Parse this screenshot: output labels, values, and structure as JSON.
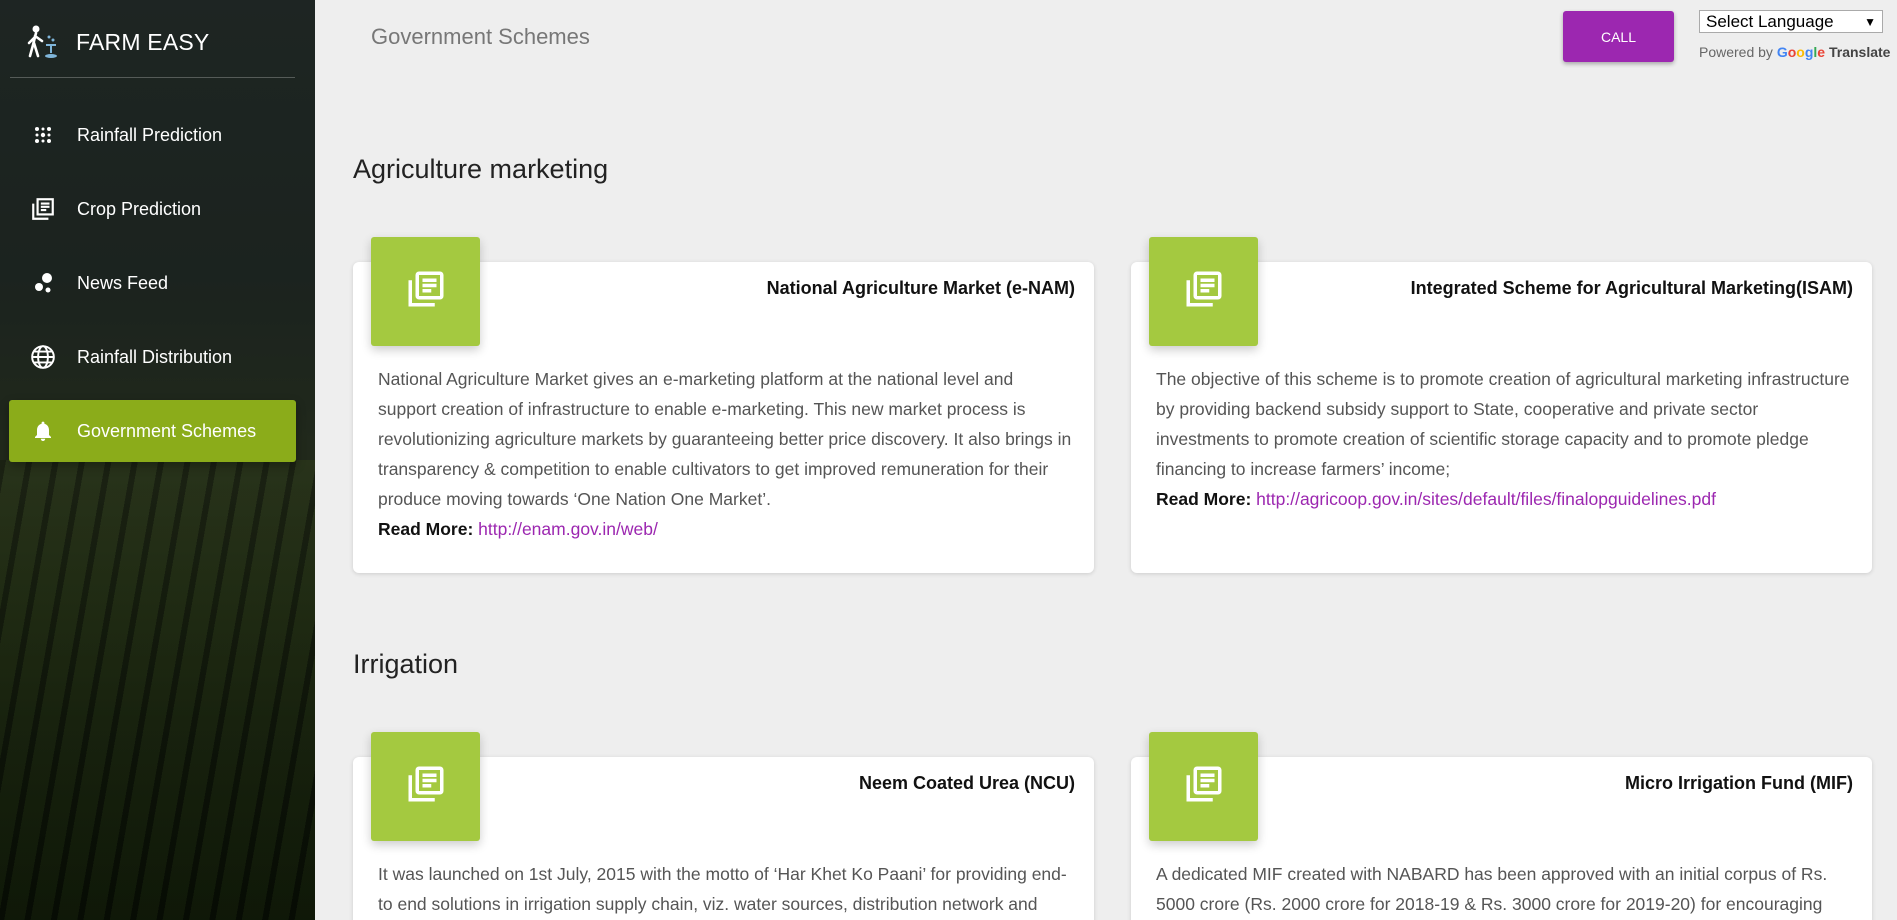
{
  "sidebar": {
    "brand": "FARM EASY",
    "items": [
      {
        "label": "Rainfall Prediction",
        "icon": "dots-icon"
      },
      {
        "label": "Crop Prediction",
        "icon": "library-books-icon"
      },
      {
        "label": "News Feed",
        "icon": "bubble-chart-icon"
      },
      {
        "label": "Rainfall Distribution",
        "icon": "globe-icon"
      },
      {
        "label": "Government Schemes",
        "icon": "bell-icon",
        "active": true
      }
    ]
  },
  "header": {
    "title": "Government Schemes",
    "call_label": "CALL",
    "language_select": "Select Language",
    "powered_by": "Powered by",
    "google": "Google",
    "translate": "Translate"
  },
  "sections": [
    {
      "title": "Agriculture marketing",
      "cards": [
        {
          "title": "National Agriculture Market (e-NAM)",
          "body": "National Agriculture Market gives an e-marketing platform at the national level and support creation of infrastructure to enable e-marketing. This new market process is revolutionizing agriculture markets by guaranteeing better price discovery. It also brings in transparency & competition to enable cultivators to get improved remuneration for their produce moving towards ‘One Nation One Market’.",
          "read_more": "Read More:",
          "link": "http://enam.gov.in/web/"
        },
        {
          "title": "Integrated Scheme for Agricultural Marketing(ISAM)",
          "body": "The objective of this scheme is to promote creation of agricultural marketing infrastructure by providing backend subsidy support to State, cooperative and private sector investments to promote creation of scientific storage capacity and to promote pledge financing to increase farmers’ income;",
          "read_more": "Read More:",
          "link": "http://agricoop.gov.in/sites/default/files/finalopguidelines.pdf"
        }
      ]
    },
    {
      "title": "Irrigation",
      "cards": [
        {
          "title": "Neem Coated Urea (NCU)",
          "body": "It was launched on 1st July, 2015 with the motto of ‘Har Khet Ko Paani’ for providing end-to end solutions in irrigation supply chain, viz. water sources, distribution network and farm"
        },
        {
          "title": "Micro Irrigation Fund (MIF)",
          "body": "A dedicated MIF created with NABARD has been approved with an initial corpus of Rs. 5000 crore (Rs. 2000 crore for 2018-19 & Rs. 3000 crore for 2019-20) for encouraging"
        }
      ]
    }
  ],
  "colors": {
    "accent_purple": "#9c27b0",
    "active_green": "#8bac1a",
    "badge_green": "#a4c940"
  }
}
